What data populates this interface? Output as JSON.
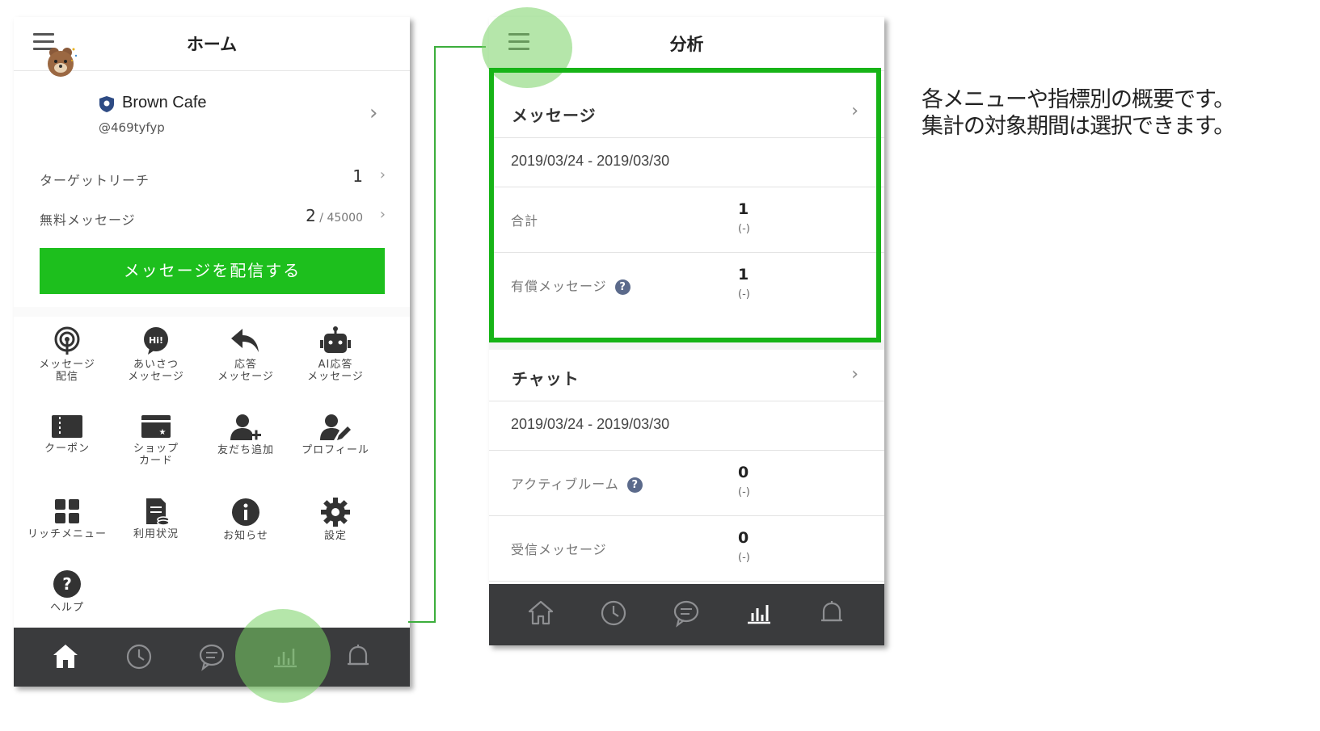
{
  "colors": {
    "accent": "#1dbf1d",
    "highlight": "#17b417",
    "nav_bg": "#3a3b3d"
  },
  "home_screen": {
    "title": "ホーム",
    "account": {
      "name": "Brown Cafe",
      "id": "@469tyfyp"
    },
    "stats": [
      {
        "label": "ターゲットリーチ",
        "value": "1",
        "total": ""
      },
      {
        "label": "無料メッセージ",
        "value": "2",
        "total": " / 45000"
      }
    ],
    "send_button": "メッセージを配信する",
    "menu_tiles": [
      {
        "label": "メッセージ\n配信",
        "icon": "broadcast-icon"
      },
      {
        "label": "あいさつ\nメッセージ",
        "icon": "greeting-bubble-icon"
      },
      {
        "label": "応答\nメッセージ",
        "icon": "reply-arrow-icon"
      },
      {
        "label": "AI応答\nメッセージ",
        "icon": "robot-icon"
      },
      {
        "label": "クーポン",
        "icon": "coupon-icon"
      },
      {
        "label": "ショップ\nカード",
        "icon": "shop-card-icon"
      },
      {
        "label": "友だち追加",
        "icon": "add-friend-icon"
      },
      {
        "label": "プロフィール",
        "icon": "profile-edit-icon"
      },
      {
        "label": "リッチメニュー",
        "icon": "rich-menu-icon"
      },
      {
        "label": "利用状況",
        "icon": "usage-icon"
      },
      {
        "label": "お知らせ",
        "icon": "info-icon"
      },
      {
        "label": "設定",
        "icon": "gear-icon"
      },
      {
        "label": "ヘルプ",
        "icon": "help-icon"
      }
    ],
    "bottom_nav": [
      "home-icon",
      "clock-icon",
      "chat-icon",
      "chart-icon",
      "bell-icon"
    ],
    "active_nav": "home-icon"
  },
  "analysis_screen": {
    "title": "分析",
    "sections": [
      {
        "title": "メッセージ",
        "date_range": "2019/03/24 - 2019/03/30",
        "metrics": [
          {
            "label": "合計",
            "value": "1",
            "change": "(-)",
            "help": false
          },
          {
            "label": "有償メッセージ",
            "value": "1",
            "change": "(-)",
            "help": true
          }
        ]
      },
      {
        "title": "チャット",
        "date_range": "2019/03/24 - 2019/03/30",
        "metrics": [
          {
            "label": "アクティブルーム",
            "value": "0",
            "change": "(-)",
            "help": true
          },
          {
            "label": "受信メッセージ",
            "value": "0",
            "change": "(-)",
            "help": false
          }
        ]
      }
    ],
    "bottom_nav": [
      "home-icon",
      "clock-icon",
      "chat-icon",
      "chart-icon",
      "bell-icon"
    ],
    "active_nav": "chart-icon"
  },
  "caption": {
    "line1": "各メニューや指標別の概要です。",
    "line2": "集計の対象期間は選択できます。"
  }
}
